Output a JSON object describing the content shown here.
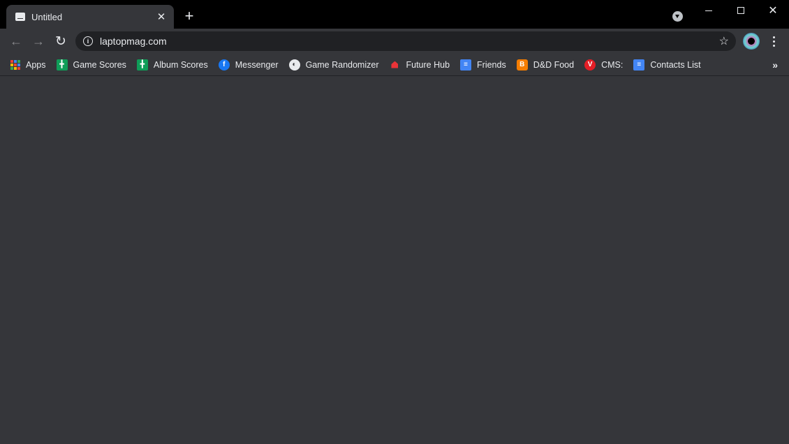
{
  "window": {
    "tab_title": "Untitled",
    "tab_close": "✕",
    "new_tab": "+",
    "close": "✕"
  },
  "toolbar": {
    "back": "←",
    "forward": "→",
    "reload": "↻",
    "info": "i",
    "url": "laptopmag.com",
    "star": "☆"
  },
  "bookmarks": [
    {
      "label": "Apps",
      "icon": "apps-grid-icon"
    },
    {
      "label": "Game Scores",
      "icon": "google-sheets-icon"
    },
    {
      "label": "Album Scores",
      "icon": "google-sheets-icon"
    },
    {
      "label": "Messenger",
      "icon": "facebook-icon",
      "glyph": "f"
    },
    {
      "label": "Game Randomizer",
      "icon": "globe-icon",
      "glyph": "◐"
    },
    {
      "label": "Future Hub",
      "icon": "future-hub-icon"
    },
    {
      "label": "Friends",
      "icon": "google-docs-icon",
      "glyph": "≡"
    },
    {
      "label": "D&D Food",
      "icon": "blogger-icon",
      "glyph": "B"
    },
    {
      "label": "CMS:",
      "icon": "vivaldi-v-icon",
      "glyph": "V"
    },
    {
      "label": "Contacts List",
      "icon": "google-docs-icon",
      "glyph": "≡"
    }
  ],
  "bookmarks_overflow": "»",
  "colors": {
    "titlebar": "#000000",
    "toolbar": "#35363a",
    "omnibox": "#202124",
    "text": "#e8eaed"
  }
}
